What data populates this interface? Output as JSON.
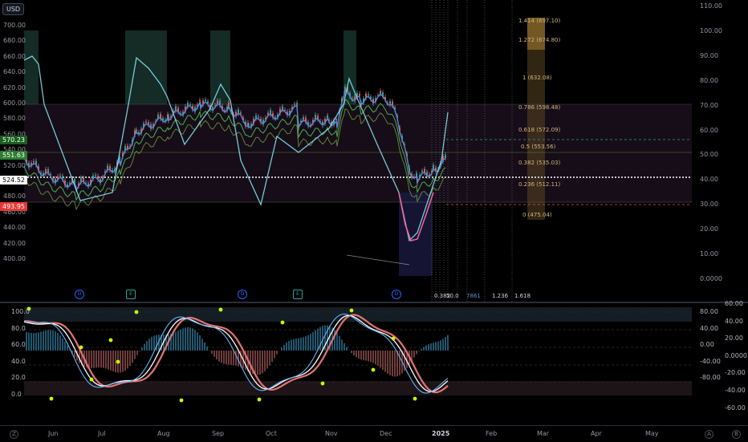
{
  "currency": "USD",
  "price_axis": [
    "700.00",
    "680.00",
    "660.00",
    "640.00",
    "620.00",
    "600.00",
    "580.00",
    "560.00",
    "540.00",
    "520.00",
    "500.00",
    "480.00",
    "460.00",
    "440.00",
    "420.00",
    "400.00"
  ],
  "price_badges": {
    "a": "570.23",
    "b": "551.63",
    "c": "524.52",
    "d": "493.95"
  },
  "rsi_axis": [
    "110.00",
    "100.00",
    "90.00",
    "80.00",
    "70.00",
    "60.00",
    "50.00",
    "40.00",
    "30.00",
    "20.00",
    "10.00",
    "0.0000"
  ],
  "fib_levels": [
    {
      "text": "1.414 (697.10)"
    },
    {
      "text": "1.272 (674.80)"
    },
    {
      "text": "1 (632.08)"
    },
    {
      "text": "0.786 (598.48)"
    },
    {
      "text": "0.618 (572.09)"
    },
    {
      "text": "0.5 (553.56)"
    },
    {
      "text": "0.382 (535.03)"
    },
    {
      "text": "0.236 (512.11)"
    },
    {
      "text": "0 (475.04)"
    }
  ],
  "fib_bottom": {
    "a": "0.382",
    "b": "50.0",
    "c": "7861",
    "d": "1.236",
    "e": "1.618"
  },
  "events": [
    "D",
    "E",
    "D",
    "E",
    "D"
  ],
  "osc_left_axis": [
    "100.0",
    "80.0",
    "60.0",
    "40.0",
    "20.0",
    "0.0"
  ],
  "osc_right_axis": [
    "80.00",
    "40.00",
    "0.00",
    "-40.00",
    "-80.00"
  ],
  "osc_right_axis_outer": [
    "60.00",
    "40.00",
    "20.00",
    "0.0000",
    "-20.00",
    "-40.00",
    "-60.00"
  ],
  "x_axis": [
    "Jun",
    "Jul",
    "Aug",
    "Sep",
    "Oct",
    "Nov",
    "Dec",
    "2025",
    "Feb",
    "Mar",
    "Apr",
    "May"
  ],
  "corner_left": "Z",
  "corner_right": [
    "A",
    "B"
  ],
  "colors": {
    "up": "#26a69a",
    "down": "#ef5350",
    "fib": "#c8a46a",
    "rsi": "#ce93d8",
    "cyan": "#80deea"
  }
}
